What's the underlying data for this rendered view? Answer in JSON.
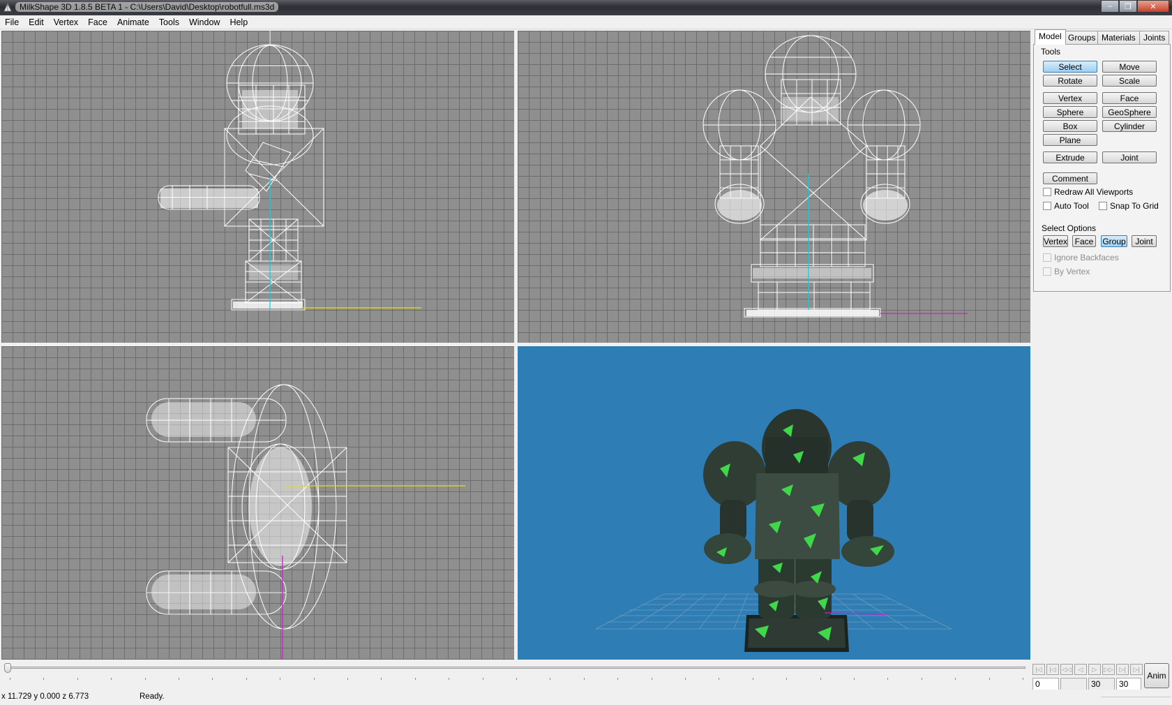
{
  "window": {
    "title": "MilkShape 3D 1.8.5 BETA 1 - C:\\Users\\David\\Desktop\\robotfull.ms3d",
    "minimize_glyph": "–",
    "maximize_glyph": "❐",
    "close_glyph": "✕"
  },
  "menu": [
    "File",
    "Edit",
    "Vertex",
    "Face",
    "Animate",
    "Tools",
    "Window",
    "Help"
  ],
  "panel": {
    "tabs": [
      "Model",
      "Groups",
      "Materials",
      "Joints"
    ],
    "tools_label": "Tools",
    "tools": {
      "select": "Select",
      "move": "Move",
      "rotate": "Rotate",
      "scale": "Scale",
      "vertex": "Vertex",
      "face": "Face",
      "sphere": "Sphere",
      "geosphere": "GeoSphere",
      "box": "Box",
      "cylinder": "Cylinder",
      "plane": "Plane",
      "extrude": "Extrude",
      "joint": "Joint",
      "comment": "Comment"
    },
    "redraw_all": "Redraw All Viewports",
    "auto_tool": "Auto Tool",
    "snap_to_grid": "Snap To Grid",
    "select_options_label": "Select Options",
    "select_options": {
      "vertex": "Vertex",
      "face": "Face",
      "group": "Group",
      "joint": "Joint"
    },
    "ignore_backfaces": "Ignore Backfaces",
    "by_vertex": "By Vertex"
  },
  "animation": {
    "current_frame": "0",
    "frame_field_2": "30",
    "frame_field_3": "30",
    "anim_label": "Anim",
    "buttons": [
      "|◁",
      "|◁",
      "◁◁",
      "◁",
      "▷",
      "▷▷",
      "▷|",
      "▷|"
    ]
  },
  "status": {
    "coords": "x 11.729 y 0.000 z 6.773",
    "message": "Ready."
  },
  "colors": {
    "grid_bg": "#8f8f8f",
    "grid_line": "#6c6c6c",
    "perspective_bg": "#2f7db5",
    "axis_yellow": "#e6e000",
    "axis_cyan": "#19d3e6",
    "axis_magenta": "#d219d2",
    "selected_button": "#9fd0f2"
  },
  "icons": [
    "app-icon",
    "minimize-icon",
    "maximize-icon",
    "close-icon"
  ]
}
